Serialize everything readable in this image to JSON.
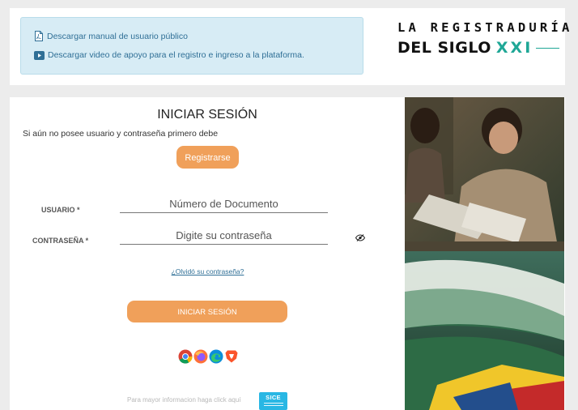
{
  "info": {
    "manual_label": "Descargar manual de usuario público",
    "video_label": "Descargar video de apoyo para el registro e ingreso a la plataforma."
  },
  "brand": {
    "line1": "LA REGISTRADURÍA",
    "line2_main": "DEL SIGLO",
    "line2_accent": "XXI"
  },
  "login": {
    "title": "INICIAR SESIÓN",
    "helper_text": "Si aún no posee usuario y contraseña primero debe",
    "register_label": "Registrarse",
    "user_label": "USUARIO *",
    "user_placeholder": "Número de Documento",
    "password_label": "CONTRASEÑA *",
    "password_placeholder": "Digite su contraseña",
    "forgot_label": "¿Olvidó su contraseña?",
    "submit_label": "INICIAR SESIÓN"
  },
  "footer": {
    "info_text": "Para mayor informacion haga click aquí",
    "sice_label": "SICE"
  },
  "icons": [
    "pdf-icon",
    "video-icon",
    "eye-icon",
    "chrome-icon",
    "firefox-icon",
    "edge-icon",
    "brave-icon"
  ],
  "colors": {
    "accent_orange": "#f0a05a",
    "info_bg": "#d7ecf5",
    "link_blue": "#2f6f96",
    "brand_teal": "#1fa796",
    "sice_blue": "#29b7e4"
  }
}
